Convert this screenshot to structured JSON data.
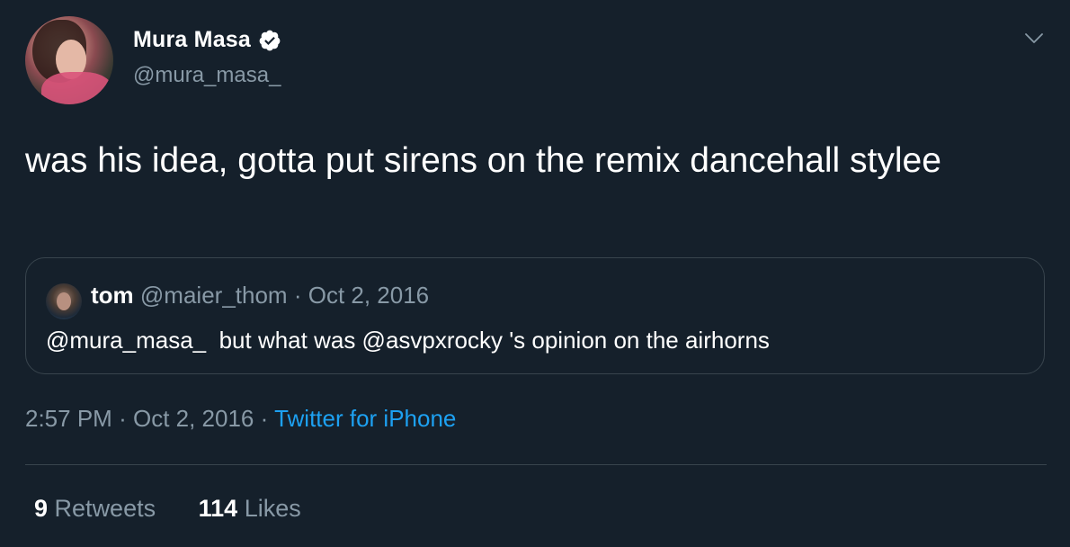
{
  "author": {
    "display_name": "Mura Masa",
    "handle": "@mura_masa_",
    "verified": true
  },
  "tweet": {
    "text": "was his idea, gotta put sirens on the remix dancehall stylee"
  },
  "quoted_tweet": {
    "name": "tom",
    "handle": "@maier_thom",
    "separator": "·",
    "date": "Oct 2, 2016",
    "text": "@mura_masa_  but what was @asvpxrocky 's opinion on the airhorns"
  },
  "meta": {
    "time": "2:57 PM",
    "separator": "·",
    "date": "Oct 2, 2016",
    "source": "Twitter for iPhone"
  },
  "stats": {
    "retweets_count": "9",
    "retweets_label": "Retweets",
    "likes_count": "114",
    "likes_label": "Likes"
  },
  "colors": {
    "background": "#15202b",
    "secondary_text": "#8899a6",
    "accent": "#1da1f2",
    "border": "#38444d"
  },
  "icons": {
    "verified": "verified-badge-icon",
    "menu": "chevron-down-icon"
  }
}
